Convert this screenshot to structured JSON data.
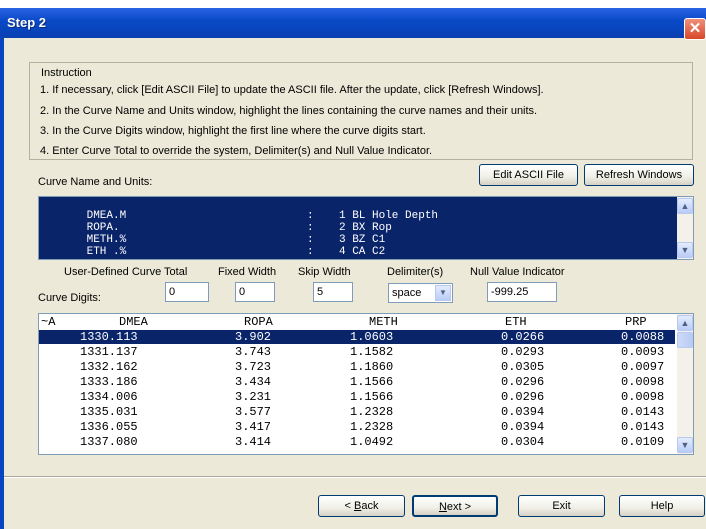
{
  "dialog": {
    "title": "Step 2",
    "close_symbol": "✕"
  },
  "instruction": {
    "legend": "Instruction",
    "lines": [
      "1. If necessary, click [Edit ASCII File] to update the ASCII file. After the update, click [Refresh Windows].",
      "2. In the Curve Name and Units window, highlight the lines containing the curve names and their units.",
      "3. In the Curve Digits window, highlight the first line where the curve digits start.",
      "4. Enter Curve Total to override the system, Delimiter(s) and Null Value Indicator."
    ]
  },
  "curve_names": {
    "label": "Curve Name and Units:",
    "edit_button": "Edit ASCII File",
    "refresh_button": "Refresh Windows",
    "rows": [
      {
        "name": "DMEA.M",
        "sep": ":",
        "desc": "1 BL Hole Depth"
      },
      {
        "name": "ROPA.",
        "sep": ":",
        "desc": "2 BX Rop"
      },
      {
        "name": "METH.%",
        "sep": ":",
        "desc": "3 BZ C1"
      },
      {
        "name": "ETH .%",
        "sep": ":",
        "desc": "4 CA C2"
      }
    ]
  },
  "options": {
    "curve_total_label": "User-Defined Curve Total",
    "curve_total_value": "0",
    "fixed_width_label": "Fixed Width",
    "fixed_width_value": "0",
    "skip_width_label": "Skip Width",
    "skip_width_value": "5",
    "delimiter_label": "Delimiter(s)",
    "delimiter_value": "space",
    "null_label": "Null Value Indicator",
    "null_value": "-999.25"
  },
  "curve_digits": {
    "label": "Curve Digits:",
    "header": [
      "~A",
      "DMEA",
      "ROPA",
      "METH",
      "ETH",
      "PRP"
    ],
    "rows": [
      [
        "1330.113",
        "3.902",
        "1.0603",
        "0.0266",
        "0.0088"
      ],
      [
        "1331.137",
        "3.743",
        "1.1582",
        "0.0293",
        "0.0093"
      ],
      [
        "1332.162",
        "3.723",
        "1.1860",
        "0.0305",
        "0.0097"
      ],
      [
        "1333.186",
        "3.434",
        "1.1566",
        "0.0296",
        "0.0098"
      ],
      [
        "1334.006",
        "3.231",
        "1.1566",
        "0.0296",
        "0.0098"
      ],
      [
        "1335.031",
        "3.577",
        "1.2328",
        "0.0394",
        "0.0143"
      ],
      [
        "1336.055",
        "3.417",
        "1.2328",
        "0.0394",
        "0.0143"
      ],
      [
        "1337.080",
        "3.414",
        "1.0492",
        "0.0304",
        "0.0109"
      ]
    ],
    "selected_row": 0
  },
  "footer": {
    "back_label": "< Back",
    "back_mnemonic": "B",
    "next_label": "Next >",
    "next_mnemonic": "N",
    "exit_label": "Exit",
    "help_label": "Help"
  },
  "colors": {
    "selection": "#0a246a",
    "dialog_bg": "#ece9d8",
    "titlebar": "#0845be"
  }
}
